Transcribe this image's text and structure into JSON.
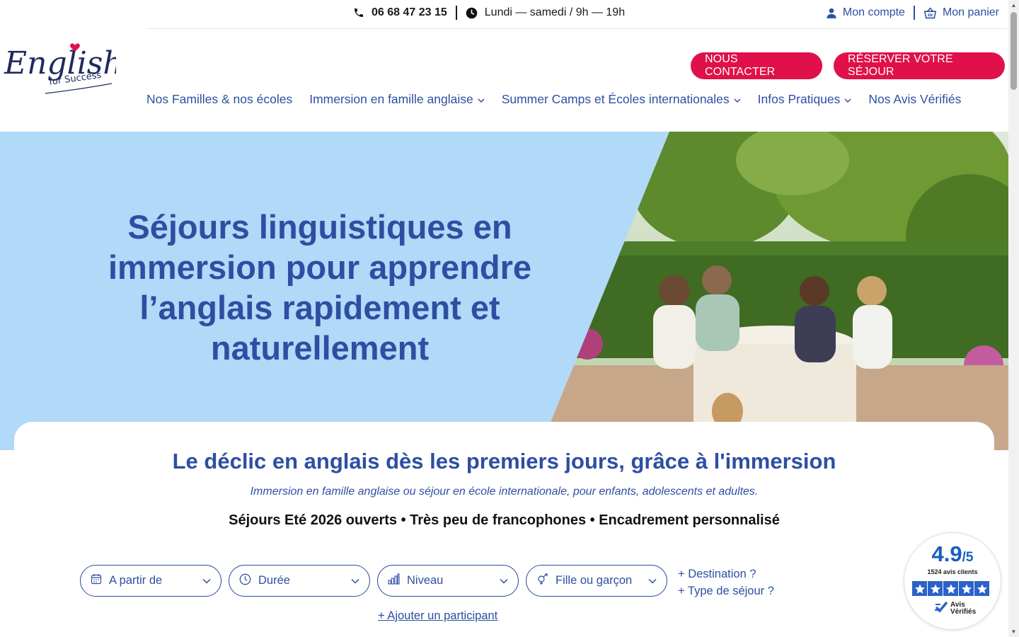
{
  "topbar": {
    "phone": "06 68 47 23 15",
    "hours": "Lundi — samedi / 9h — 19h",
    "account": "Mon compte",
    "cart": "Mon panier"
  },
  "logo": {
    "line1": "English",
    "line2": "for Success"
  },
  "cta": {
    "contact": "NOUS CONTACTER",
    "reserve": "RÉSERVER VOTRE SÉJOUR"
  },
  "nav": [
    {
      "label": "Nos Familles & nos écoles",
      "dropdown": false
    },
    {
      "label": "Immersion en famille anglaise",
      "dropdown": true
    },
    {
      "label": "Summer Camps et Écoles internationales",
      "dropdown": true
    },
    {
      "label": "Infos Pratiques",
      "dropdown": true
    },
    {
      "label": "Nos Avis Vérifiés",
      "dropdown": false
    }
  ],
  "hero": {
    "title": "Séjours linguistiques en immersion pour apprendre l’anglais rapidement et naturellement"
  },
  "section": {
    "title": "Le déclic en anglais dès les premiers jours, grâce à l'immersion",
    "subtitle": "Immersion en famille anglaise ou séjour en école internationale, pour enfants, adolescents et adultes.",
    "tagline": "Séjours Eté 2026 ouverts • Très peu de francophones • Encadrement personnalisé"
  },
  "filters": {
    "start": "A partir de",
    "duration": "Durée",
    "level": "Niveau",
    "gender": "Fille ou garçon",
    "destination": "+ Destination ?",
    "type": "+ Type de séjour ?",
    "add_participant": "+ Ajouter un participant"
  },
  "rating": {
    "score": "4.9",
    "scale": "/5",
    "count": "1524 avis clients",
    "brand_line1": "Avis",
    "brand_line2": "Vérifiés"
  },
  "colors": {
    "brand_blue": "#2d4fa2",
    "cta_red": "#e0104a",
    "hero_bg": "#b1d9f8"
  }
}
